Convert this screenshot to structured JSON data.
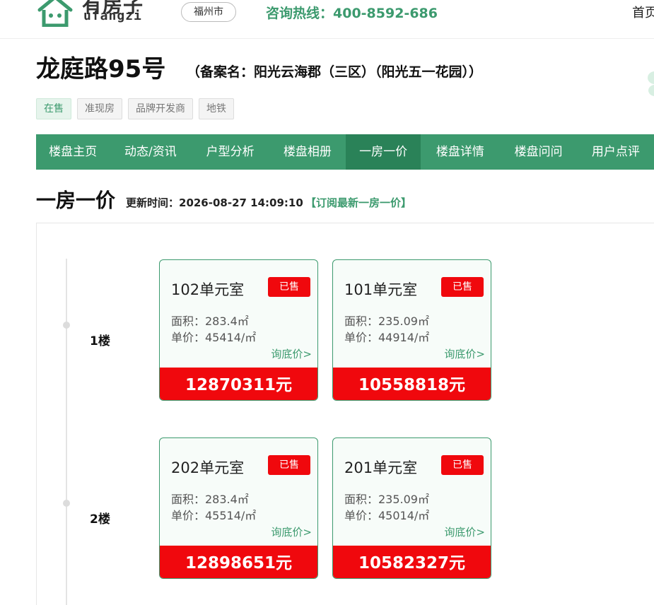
{
  "header": {
    "logo_cn": "有房子",
    "logo_en": "ufangzi",
    "city": "福州市",
    "hotline": "咨询热线：400-8592-686",
    "nav_home": "首页"
  },
  "property": {
    "title": "龙庭路95号",
    "subtitle": "（备案名：阳光云海郡（三区）（阳光五一花园））",
    "tags": [
      "在售",
      "准现房",
      "品牌开发商",
      "地铁"
    ]
  },
  "navbar": {
    "items": [
      "楼盘主页",
      "动态/资讯",
      "户型分析",
      "楼盘相册",
      "一房一价",
      "楼盘详情",
      "楼盘问问",
      "用户点评"
    ],
    "active": "一房一价"
  },
  "section": {
    "title": "一房一价",
    "update_time": "更新时间：2026-08-27 14:09:10",
    "subscribe": "【订阅最新一房一价】"
  },
  "floors": [
    {
      "label": "1楼",
      "units": [
        {
          "room": "102单元室",
          "status": "已售",
          "area": "面积：283.4㎡",
          "unit_price": "单价：45414/㎡",
          "ask": "询底价>",
          "total": "12870311元"
        },
        {
          "room": "101单元室",
          "status": "已售",
          "area": "面积：235.09㎡",
          "unit_price": "单价：44914/㎡",
          "ask": "询底价>",
          "total": "10558818元"
        }
      ]
    },
    {
      "label": "2楼",
      "units": [
        {
          "room": "202单元室",
          "status": "已售",
          "area": "面积：283.4㎡",
          "unit_price": "单价：45514/㎡",
          "ask": "询底价>",
          "total": "12898651元"
        },
        {
          "room": "201单元室",
          "status": "已售",
          "area": "面积：235.09㎡",
          "unit_price": "单价：45014/㎡",
          "ask": "询底价>",
          "total": "10582327元"
        }
      ]
    }
  ],
  "colors": {
    "brand_green": "#3c9a6e",
    "nav_active": "#2a8258",
    "sold_red": "#f0080d"
  }
}
